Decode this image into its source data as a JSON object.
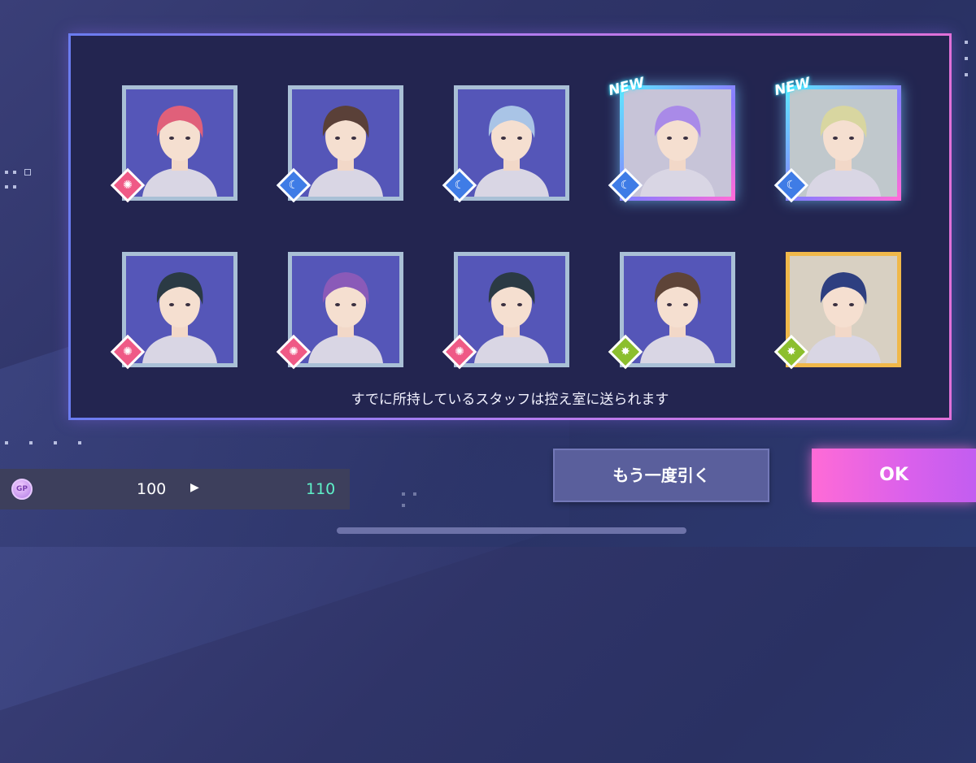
{
  "note_text": "すでに所持しているスタッフは控え室に送られます",
  "new_label": "NEW",
  "gp": {
    "icon_label": "GP",
    "from": "100",
    "arrow": "▶",
    "to": "110"
  },
  "buttons": {
    "retry_label": "もう一度引く",
    "ok_label": "OK"
  },
  "cards": [
    {
      "attribute": "sun-icon",
      "is_new": false,
      "hair": "#e0607a",
      "bg": "#5556b8"
    },
    {
      "attribute": "moon-icon",
      "is_new": false,
      "hair": "#5a4038",
      "bg": "#5556b8"
    },
    {
      "attribute": "moon-icon",
      "is_new": false,
      "hair": "#a9c4e6",
      "bg": "#5556b8"
    },
    {
      "attribute": "moon-icon",
      "is_new": true,
      "hair": "#a98ae8",
      "bg": "#c7c4d8"
    },
    {
      "attribute": "moon-icon",
      "is_new": true,
      "hair": "#d8d6a0",
      "bg": "#c0c8cc"
    },
    {
      "attribute": "sun-icon",
      "is_new": false,
      "hair": "#2b3a44",
      "bg": "#5556b8"
    },
    {
      "attribute": "sun-icon",
      "is_new": false,
      "hair": "#8a5ab8",
      "bg": "#5556b8"
    },
    {
      "attribute": "sun-icon",
      "is_new": false,
      "hair": "#2b3a44",
      "bg": "#5556b8"
    },
    {
      "attribute": "star-icon",
      "is_new": false,
      "hair": "#5e4438",
      "bg": "#5556b8"
    },
    {
      "attribute": "star-icon",
      "is_new": false,
      "hair": "#2e3f80",
      "bg": "#d8d0c2"
    }
  ]
}
